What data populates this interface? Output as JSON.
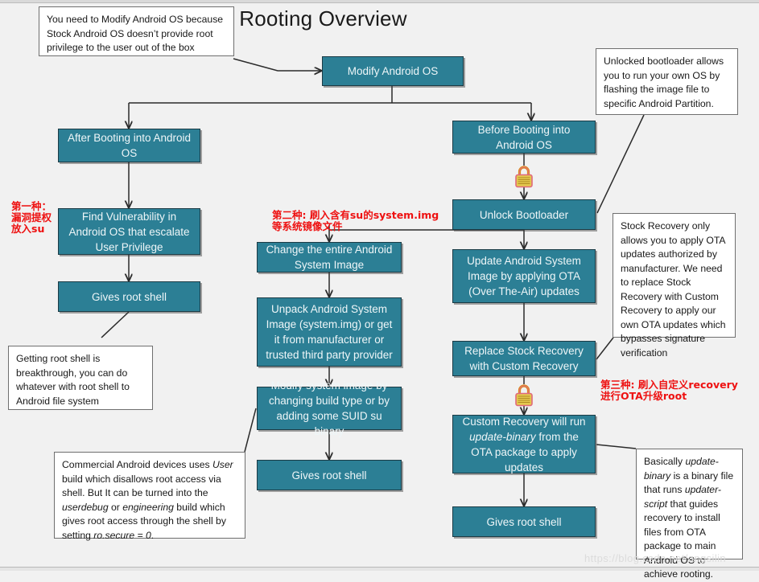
{
  "diagram": {
    "title": "Rooting Overview",
    "watermark": "https://blog.csdn.net/angsilin",
    "accent_color": "#2c7f95",
    "note_border_color": "#6f6f6f",
    "annotation_color": "#ee1111",
    "background_color": "#f1f1f1"
  },
  "nodes": {
    "modify_android_os": "Modify Android OS",
    "after_booting": "After Booting into Android OS",
    "find_vulnerability": "Find Vulnerability in Android OS that escalate User Privilege",
    "gives_root_shell_left": "Gives root shell",
    "change_system_image": "Change the entire Android System Image",
    "unpack_system_image": "Unpack Android System Image (system.img) or get it from manufacturer or trusted third party provider",
    "modify_system_image": "Modify system image by changing build type or by adding some SUID su binary",
    "gives_root_shell_middle": "Gives root shell",
    "before_booting": "Before Booting into Android OS",
    "unlock_bootloader": "Unlock Bootloader",
    "update_ota": "Update Android System Image by applying OTA (Over The-Air) updates",
    "replace_recovery": "Replace Stock Recovery with Custom Recovery",
    "custom_recovery_run": {
      "part1": "Custom Recovery will run ",
      "emphasis": "update-binary",
      "part2": " from the OTA package to apply updates"
    },
    "gives_root_shell_right": "Gives root shell"
  },
  "notes": {
    "modify_os_note": "You need to Modify Android OS because Stock Android OS doesn’t provide root privilege to the user out of the box",
    "bootloader_note": "Unlocked bootloader allows you to run your own OS by flashing the image file to specific Android Partition.",
    "recovery_note": "Stock Recovery only allows you to apply OTA updates authorized by manufacturer. We need to replace Stock Recovery with Custom Recovery to apply our own OTA updates which bypasses signature verification",
    "root_shell_note": "Getting root shell is breakthrough, you can do whatever with root shell to Android file system",
    "commercial_note": {
      "part1": "Commercial Android devices uses ",
      "em1": "User",
      "part2": " build which disallows root access via shell. But It can be turned into the ",
      "em2": "userdebug",
      "part3": " or ",
      "em3": "engineering",
      "part4": " build which gives root access through the shell by setting ",
      "em4": "ro.secure = 0",
      "part5": "."
    },
    "update_binary_note": {
      "part1": "Basically ",
      "em1": "update-binary",
      "part2": " is a binary file that runs ",
      "em2": "updater-script",
      "part3": " that guides recovery to install files from OTA package to main Android OS to achieve rooting."
    }
  },
  "annotations": {
    "method_one": "第一种：\n漏洞提权\n放入su",
    "method_two": "第二种: 刷入含有su的system.img\n等系统镜像文件",
    "method_three": "第三种: 刷入自定义recovery\n进行OTA升级root"
  },
  "icons": {
    "lock_bootloader": "padlock-icon",
    "lock_recovery": "padlock-icon"
  }
}
